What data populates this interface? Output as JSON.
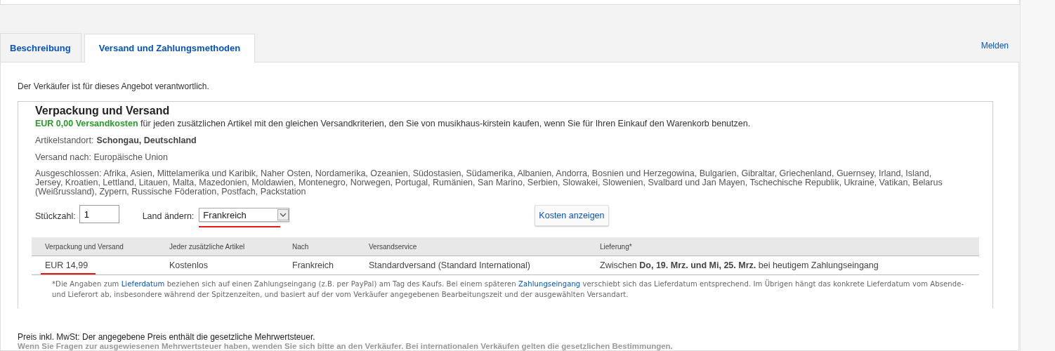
{
  "tabs": [
    {
      "label": "Beschreibung",
      "selected": false
    },
    {
      "label": "Versand und Zahlungsmethoden",
      "selected": true
    }
  ],
  "report_link": "Melden",
  "seller_note": "Der Verkäufer ist für dieses Angebot verantwortlich.",
  "shipping": {
    "title": "Verpackung und Versand",
    "offer": "**EUR 0,00 Versandkosten** für jeden zusätzlichen Artikel mit den gleichen Versandkriterien, den Sie von musikhaus-kirstein kaufen, wenn Sie für Ihren Einkauf den Warenkorb benutzen.",
    "location_label": "Artikelstandort:",
    "location": "Schongau, Deutschland",
    "ships_to": "Versand nach: Europäische Union",
    "excluded": "Ausgeschlossen: Afrika, Asien, Mittelamerika und Karibik, Naher Osten, Nordamerika, Ozeanien, Südostasien, Südamerika, Albanien, Andorra, Bosnien und Herzegowina, Bulgarien, Gibraltar, Griechenland, Guernsey, Irland, Island, Jersey, Kroatien, Lettland, Litauen, Malta, Mazedonien, Moldawien, Montenegro, Norwegen, Portugal, Rumänien, San Marino, Serbien, Slowakei, Slowenien, Svalbard und Jan Mayen, Tschechische Republik, Ukraine, Vatikan, Belarus (Weißrussland), Zypern, Russische Föderation, Postfach, Packstation",
    "quantity_label": "Stückzahl:",
    "quantity": "1",
    "country_label": "Land ändern:",
    "country": "Frankreich",
    "button": "Kosten anzeigen",
    "table": {
      "columns": [
        "Verpackung und Versand",
        "Jeder zusätzliche Artikel",
        "Nach",
        "Versandservice",
        "Lieferung*"
      ],
      "rows": [
        [
          "EUR 14,99",
          "Kostenlos",
          "Frankreich",
          "Standardversand (Standard International)",
          "Zwischen **Do, 19. Mrz. und Mi, 25. Mrz.** bei heutigem Zahlungseingang"
        ]
      ]
    },
    "footnote": [
      {
        "kind": "text",
        "text": "*Die Angaben zum"
      },
      {
        "kind": "link",
        "text": "Lieferdatum"
      },
      {
        "kind": "text",
        "text": "beziehen sich auf einen Zahlungseingang (z.B. per PayPal) am Tag des Kaufs. Bei einem späteren"
      },
      {
        "kind": "link",
        "text": "Zahlungseingang"
      },
      {
        "kind": "text",
        "text": "verschiebt sich das Lieferdatum entsprechend. Im Übrigen hängt das konkrete Lieferdatum vom Absende- und Lieferort ab, insbesondere während der Spitzenzeiten, und basiert auf der vom Verkäufer angegebenen Bearbeitungszeit und der ausgewählten Versandart."
      }
    ]
  },
  "vat_note": "Preis inkl. MwSt: Der angegebene Preis enthält die gesetzliche Mehrwertsteuer.",
  "vat_hint": "Wenn Sie Fragen zur ausgewiesenen Mehrwertsteuer haben, wenden Sie sich bitte an den Verkäufer. Bei internationalen Verkäufen gelten die gesetzlichen Bestimmungen."
}
